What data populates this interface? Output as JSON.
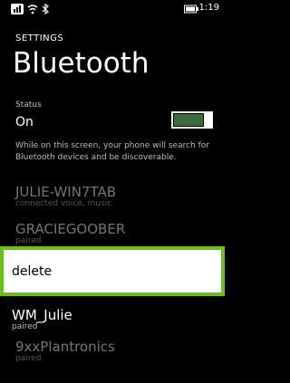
{
  "status_bar": {
    "time": "1:19",
    "icons": [
      "signal-icon",
      "wifi-icon",
      "bluetooth-icon",
      "battery-icon"
    ]
  },
  "header": {
    "section": "SETTINGS",
    "title": "Bluetooth"
  },
  "bluetooth_status": {
    "caption": "Status",
    "value": "On",
    "toggle_on": true
  },
  "info_text": "While on this screen, your phone will search for Bluetooth devices and be discoverable.",
  "devices": [
    {
      "name": "JULIE-WIN7TAB",
      "status": "connected voice, music"
    },
    {
      "name": "GRACIEGOOBER",
      "status": "paired"
    },
    {
      "name": "WM_Julie",
      "status": "paired"
    },
    {
      "name": "9xxPlantronics",
      "status": "paired"
    }
  ],
  "context_menu": {
    "items": [
      "delete"
    ],
    "accent_color": "#6dbd1f"
  },
  "colors": {
    "background": "#000000",
    "toggle_fill": "#3b6b3b",
    "highlight": "#6dbd1f"
  }
}
